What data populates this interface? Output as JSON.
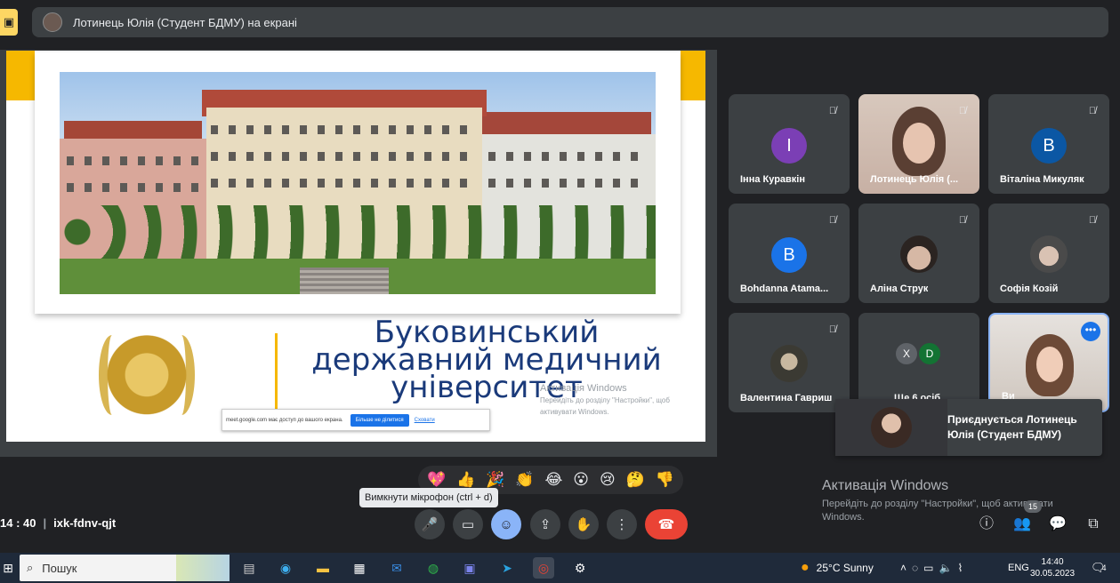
{
  "banner": {
    "presenting_text": "Лотинець Юлія (Студент БДМУ) на екрані"
  },
  "slide": {
    "university_line1": "Буковинський",
    "university_line2": "державний медичний",
    "university_line3": "університет",
    "ghost_activation_title": "Активація Windows",
    "ghost_activation_sub": "Перейдіть до розділу \"Настройки\", щоб",
    "ghost_activation_sub2": "активувати Windows."
  },
  "share_bar": {
    "message": "meet.google.com має доступ до вашого екрана.",
    "stop_label": "Більше не ділитися",
    "hide_label": "Сховати"
  },
  "participants": [
    {
      "name": "Інна Куравкін",
      "initial": "I",
      "color": "#7b3fb5",
      "type": "initial"
    },
    {
      "name": "Лотинець Юлія (...",
      "type": "video"
    },
    {
      "name": "Віталіна Микуляк",
      "initial": "В",
      "color": "#0b57a4",
      "type": "initial"
    },
    {
      "name": "Bohdanna Atama...",
      "initial": "B",
      "color": "#1a73e8",
      "type": "initial"
    },
    {
      "name": "Аліна Струк",
      "type": "photo"
    },
    {
      "name": "Софія Козій",
      "type": "photo"
    },
    {
      "name": "Валентина Гавриш",
      "type": "photo"
    },
    {
      "name": "Ще 6 осіб",
      "type": "more",
      "avatars": [
        {
          "initial": "X",
          "color": "#5f6368"
        },
        {
          "initial": "D",
          "color": "#137333"
        }
      ]
    },
    {
      "name": "Ви",
      "type": "me"
    }
  ],
  "join_toast": {
    "text": "Приєднується Лотинець Юлія (Студент БДМУ)"
  },
  "reactions": [
    "💖",
    "👍",
    "🎉",
    "👏",
    "😂",
    "😮",
    "😢",
    "🤔",
    "👎"
  ],
  "tooltip": "Вимкнути мікрофон (ctrl + d)",
  "meeting": {
    "time": "14 : 40",
    "code": "ixk-fdnv-qjt",
    "participant_count": "15"
  },
  "windows_activation": {
    "title": "Активація Windows",
    "subtitle": "Перейдіть до розділу \"Настройки\", щоб активувати Windows."
  },
  "taskbar": {
    "search_placeholder": "Пошук",
    "weather": "25°C  Sunny",
    "language": "ENG",
    "clock_time": "14:40",
    "clock_date": "30.05.2023",
    "notification_count": "4"
  },
  "colors": {
    "background": "#202124",
    "tile": "#3c4043",
    "accent_blue": "#8ab4f8",
    "end_call": "#ea4335",
    "slide_yellow": "#f6b800",
    "university_blue": "#1a3a7a"
  }
}
